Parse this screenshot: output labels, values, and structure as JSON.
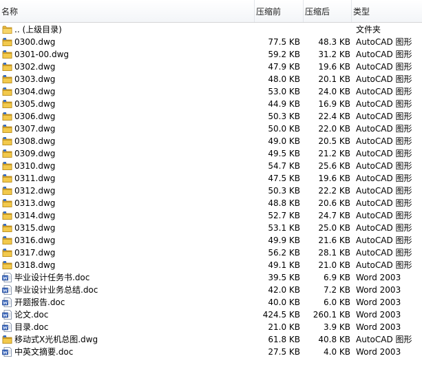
{
  "columns": {
    "name": "名称",
    "before": "压缩前",
    "after": "压缩后",
    "type": "类型"
  },
  "rows": [
    {
      "icon": "folder-icon",
      "name": ".. (上级目录)",
      "before": "",
      "after": "",
      "type": "文件夹"
    },
    {
      "icon": "dwg-file-icon",
      "name": "0300.dwg",
      "before": "77.5 KB",
      "after": "48.3 KB",
      "type": "AutoCAD 图形"
    },
    {
      "icon": "dwg-file-icon",
      "name": "0301-00.dwg",
      "before": "59.2 KB",
      "after": "31.2 KB",
      "type": "AutoCAD 图形"
    },
    {
      "icon": "dwg-file-icon",
      "name": "0302.dwg",
      "before": "47.9 KB",
      "after": "19.6 KB",
      "type": "AutoCAD 图形"
    },
    {
      "icon": "dwg-file-icon",
      "name": "0303.dwg",
      "before": "48.0 KB",
      "after": "20.1 KB",
      "type": "AutoCAD 图形"
    },
    {
      "icon": "dwg-file-icon",
      "name": "0304.dwg",
      "before": "53.0 KB",
      "after": "24.0 KB",
      "type": "AutoCAD 图形"
    },
    {
      "icon": "dwg-file-icon",
      "name": "0305.dwg",
      "before": "44.9 KB",
      "after": "16.9 KB",
      "type": "AutoCAD 图形"
    },
    {
      "icon": "dwg-file-icon",
      "name": "0306.dwg",
      "before": "50.3 KB",
      "after": "22.4 KB",
      "type": "AutoCAD 图形"
    },
    {
      "icon": "dwg-file-icon",
      "name": "0307.dwg",
      "before": "50.0 KB",
      "after": "22.0 KB",
      "type": "AutoCAD 图形"
    },
    {
      "icon": "dwg-file-icon",
      "name": "0308.dwg",
      "before": "49.0 KB",
      "after": "20.5 KB",
      "type": "AutoCAD 图形"
    },
    {
      "icon": "dwg-file-icon",
      "name": "0309.dwg",
      "before": "49.5 KB",
      "after": "21.2 KB",
      "type": "AutoCAD 图形"
    },
    {
      "icon": "dwg-file-icon",
      "name": "0310.dwg",
      "before": "54.7 KB",
      "after": "25.6 KB",
      "type": "AutoCAD 图形"
    },
    {
      "icon": "dwg-file-icon",
      "name": "0311.dwg",
      "before": "47.5 KB",
      "after": "19.6 KB",
      "type": "AutoCAD 图形"
    },
    {
      "icon": "dwg-file-icon",
      "name": "0312.dwg",
      "before": "50.3 KB",
      "after": "22.2 KB",
      "type": "AutoCAD 图形"
    },
    {
      "icon": "dwg-file-icon",
      "name": "0313.dwg",
      "before": "48.8 KB",
      "after": "20.6 KB",
      "type": "AutoCAD 图形"
    },
    {
      "icon": "dwg-file-icon",
      "name": "0314.dwg",
      "before": "52.7 KB",
      "after": "24.7 KB",
      "type": "AutoCAD 图形"
    },
    {
      "icon": "dwg-file-icon",
      "name": "0315.dwg",
      "before": "53.1 KB",
      "after": "25.0 KB",
      "type": "AutoCAD 图形"
    },
    {
      "icon": "dwg-file-icon",
      "name": "0316.dwg",
      "before": "49.9 KB",
      "after": "21.6 KB",
      "type": "AutoCAD 图形"
    },
    {
      "icon": "dwg-file-icon",
      "name": "0317.dwg",
      "before": "56.2 KB",
      "after": "28.1 KB",
      "type": "AutoCAD 图形"
    },
    {
      "icon": "dwg-file-icon",
      "name": "0318.dwg",
      "before": "49.1 KB",
      "after": "21.0 KB",
      "type": "AutoCAD 图形"
    },
    {
      "icon": "word-doc-icon",
      "name": "毕业设计任务书.doc",
      "before": "39.5 KB",
      "after": "6.9 KB",
      "type": "Word 2003"
    },
    {
      "icon": "word-doc-icon",
      "name": "毕业设计业务总结.doc",
      "before": "42.0 KB",
      "after": "7.2 KB",
      "type": "Word 2003"
    },
    {
      "icon": "word-doc-icon",
      "name": "开题报告.doc",
      "before": "40.0 KB",
      "after": "6.0 KB",
      "type": "Word 2003"
    },
    {
      "icon": "word-doc-icon",
      "name": "论文.doc",
      "before": "424.5 KB",
      "after": "260.1 KB",
      "type": "Word 2003"
    },
    {
      "icon": "word-doc-icon",
      "name": "目录.doc",
      "before": "21.0 KB",
      "after": "3.9 KB",
      "type": "Word 2003"
    },
    {
      "icon": "dwg-file-icon",
      "name": "移动式X光机总图.dwg",
      "before": "61.8 KB",
      "after": "40.8 KB",
      "type": "AutoCAD 图形"
    },
    {
      "icon": "word-doc-icon",
      "name": "中英文摘要.doc",
      "before": "27.5 KB",
      "after": "4.0 KB",
      "type": "Word 2003"
    }
  ]
}
